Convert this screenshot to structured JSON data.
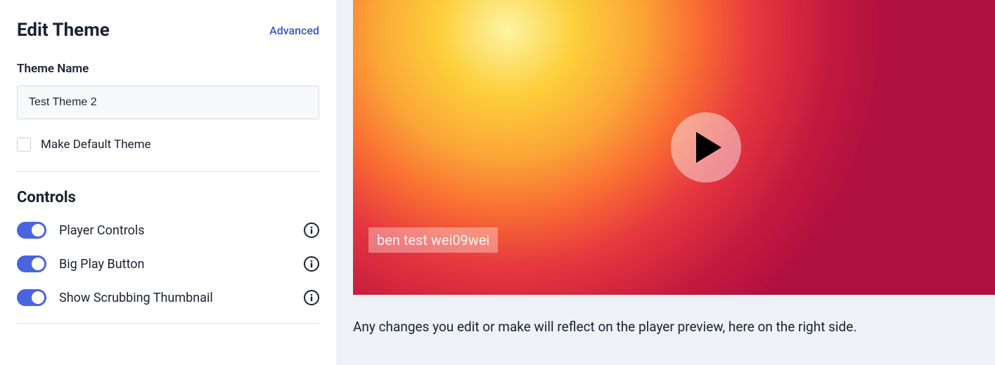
{
  "header": {
    "title": "Edit Theme",
    "advanced": "Advanced"
  },
  "theme": {
    "name_label": "Theme Name",
    "name_value": "Test Theme 2",
    "default_label": "Make Default Theme"
  },
  "controls": {
    "title": "Controls",
    "items": [
      {
        "label": "Player Controls"
      },
      {
        "label": "Big Play Button"
      },
      {
        "label": "Show Scrubbing Thumbnail"
      }
    ]
  },
  "preview": {
    "watermark": "ben test wei09wei",
    "hint": "Any changes you edit or make will reflect on the player preview, here on the right side."
  }
}
